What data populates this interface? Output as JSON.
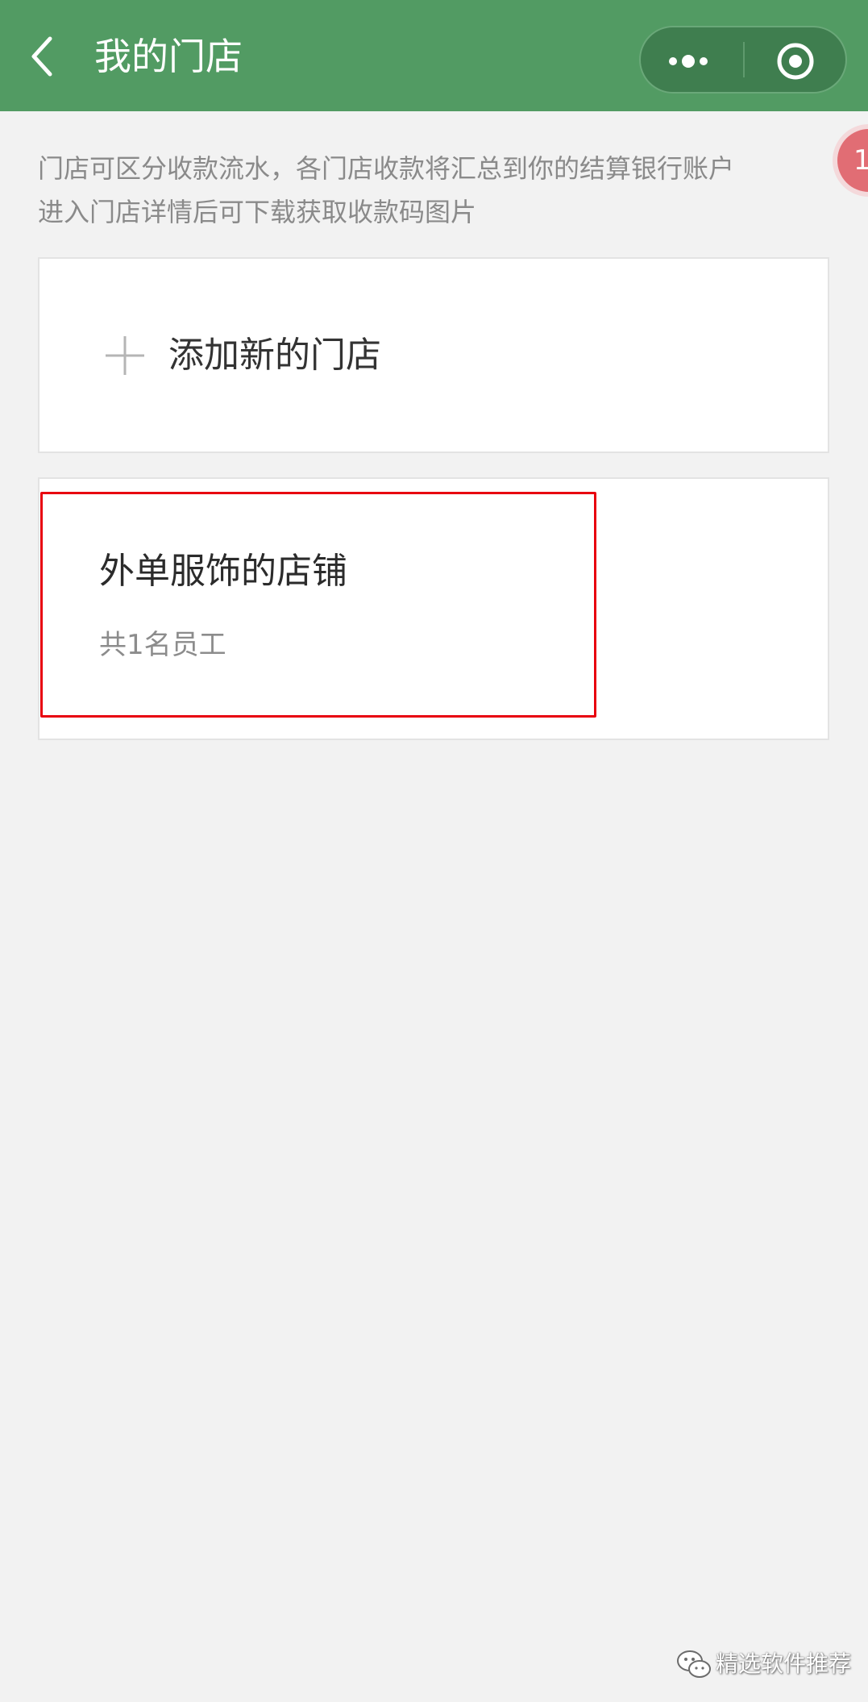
{
  "nav": {
    "title": "我的门店"
  },
  "float_badge": {
    "text": "1"
  },
  "description": {
    "line1": "门店可区分收款流水，各门店收款将汇总到你的结算银行账户",
    "line2": "进入门店详情后可下载获取收款码图片"
  },
  "add_store": {
    "label": "添加新的门店"
  },
  "store": {
    "name": "外单服饰的店铺",
    "staff": "共1名员工"
  },
  "watermark": {
    "text": "精选软件推荐"
  },
  "colors": {
    "navbar": "#529b63",
    "background": "#f2f2f2",
    "highlight": "#e8000f",
    "badge": "#e16d74"
  },
  "icons": {
    "back": "back-arrow-icon",
    "more": "more-dots-icon",
    "close": "target-close-icon",
    "add": "plus-icon",
    "watermark": "wechat-icon"
  }
}
